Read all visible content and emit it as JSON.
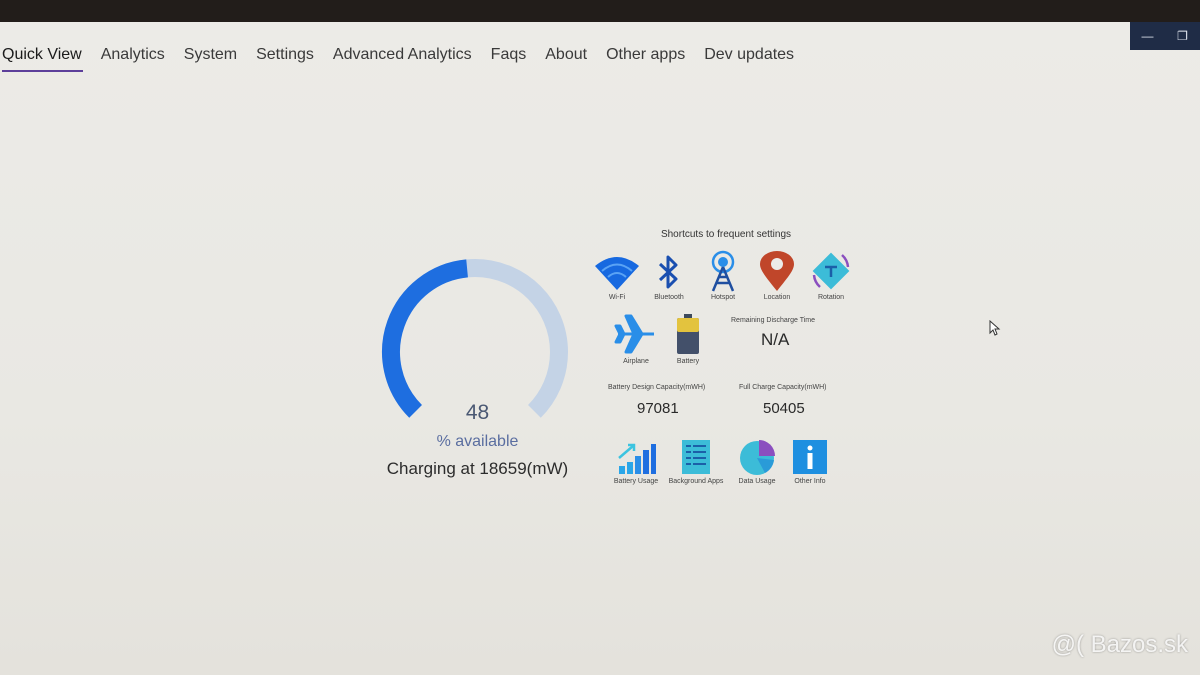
{
  "tabs": [
    {
      "label": "Quick View",
      "active": true
    },
    {
      "label": "Analytics"
    },
    {
      "label": "System"
    },
    {
      "label": "Settings"
    },
    {
      "label": "Advanced Analytics"
    },
    {
      "label": "Faqs"
    },
    {
      "label": "About"
    },
    {
      "label": "Other apps"
    },
    {
      "label": "Dev updates"
    }
  ],
  "window_controls": {
    "minimize": "—",
    "restore": "❐"
  },
  "battery": {
    "percent": 48,
    "percent_label": "% available",
    "charging_text": "Charging at 18659(mW)"
  },
  "shortcuts": {
    "title": "Shortcuts to frequent settings",
    "items": [
      "Wi-Fi",
      "Bluetooth",
      "Hotspot",
      "Location",
      "Rotation"
    ],
    "row2": [
      "Airplane",
      "Battery"
    ]
  },
  "stats": {
    "remaining_label": "Remaining Discharge Time",
    "remaining_value": "N/A",
    "design_capacity_label": "Battery Design Capacity(mWH)",
    "design_capacity_value": "97081",
    "full_charge_label": "Full Charge Capacity(mWH)",
    "full_charge_value": "50405"
  },
  "bottom_shortcuts": [
    "Battery Usage",
    "Background Apps",
    "Data Usage",
    "Other Info"
  ],
  "watermark": "@( Bazos.sk",
  "colors": {
    "accent": "#5d3f9a",
    "gauge_fill": "#1e6ee0",
    "gauge_track": "#c4d3e6"
  }
}
